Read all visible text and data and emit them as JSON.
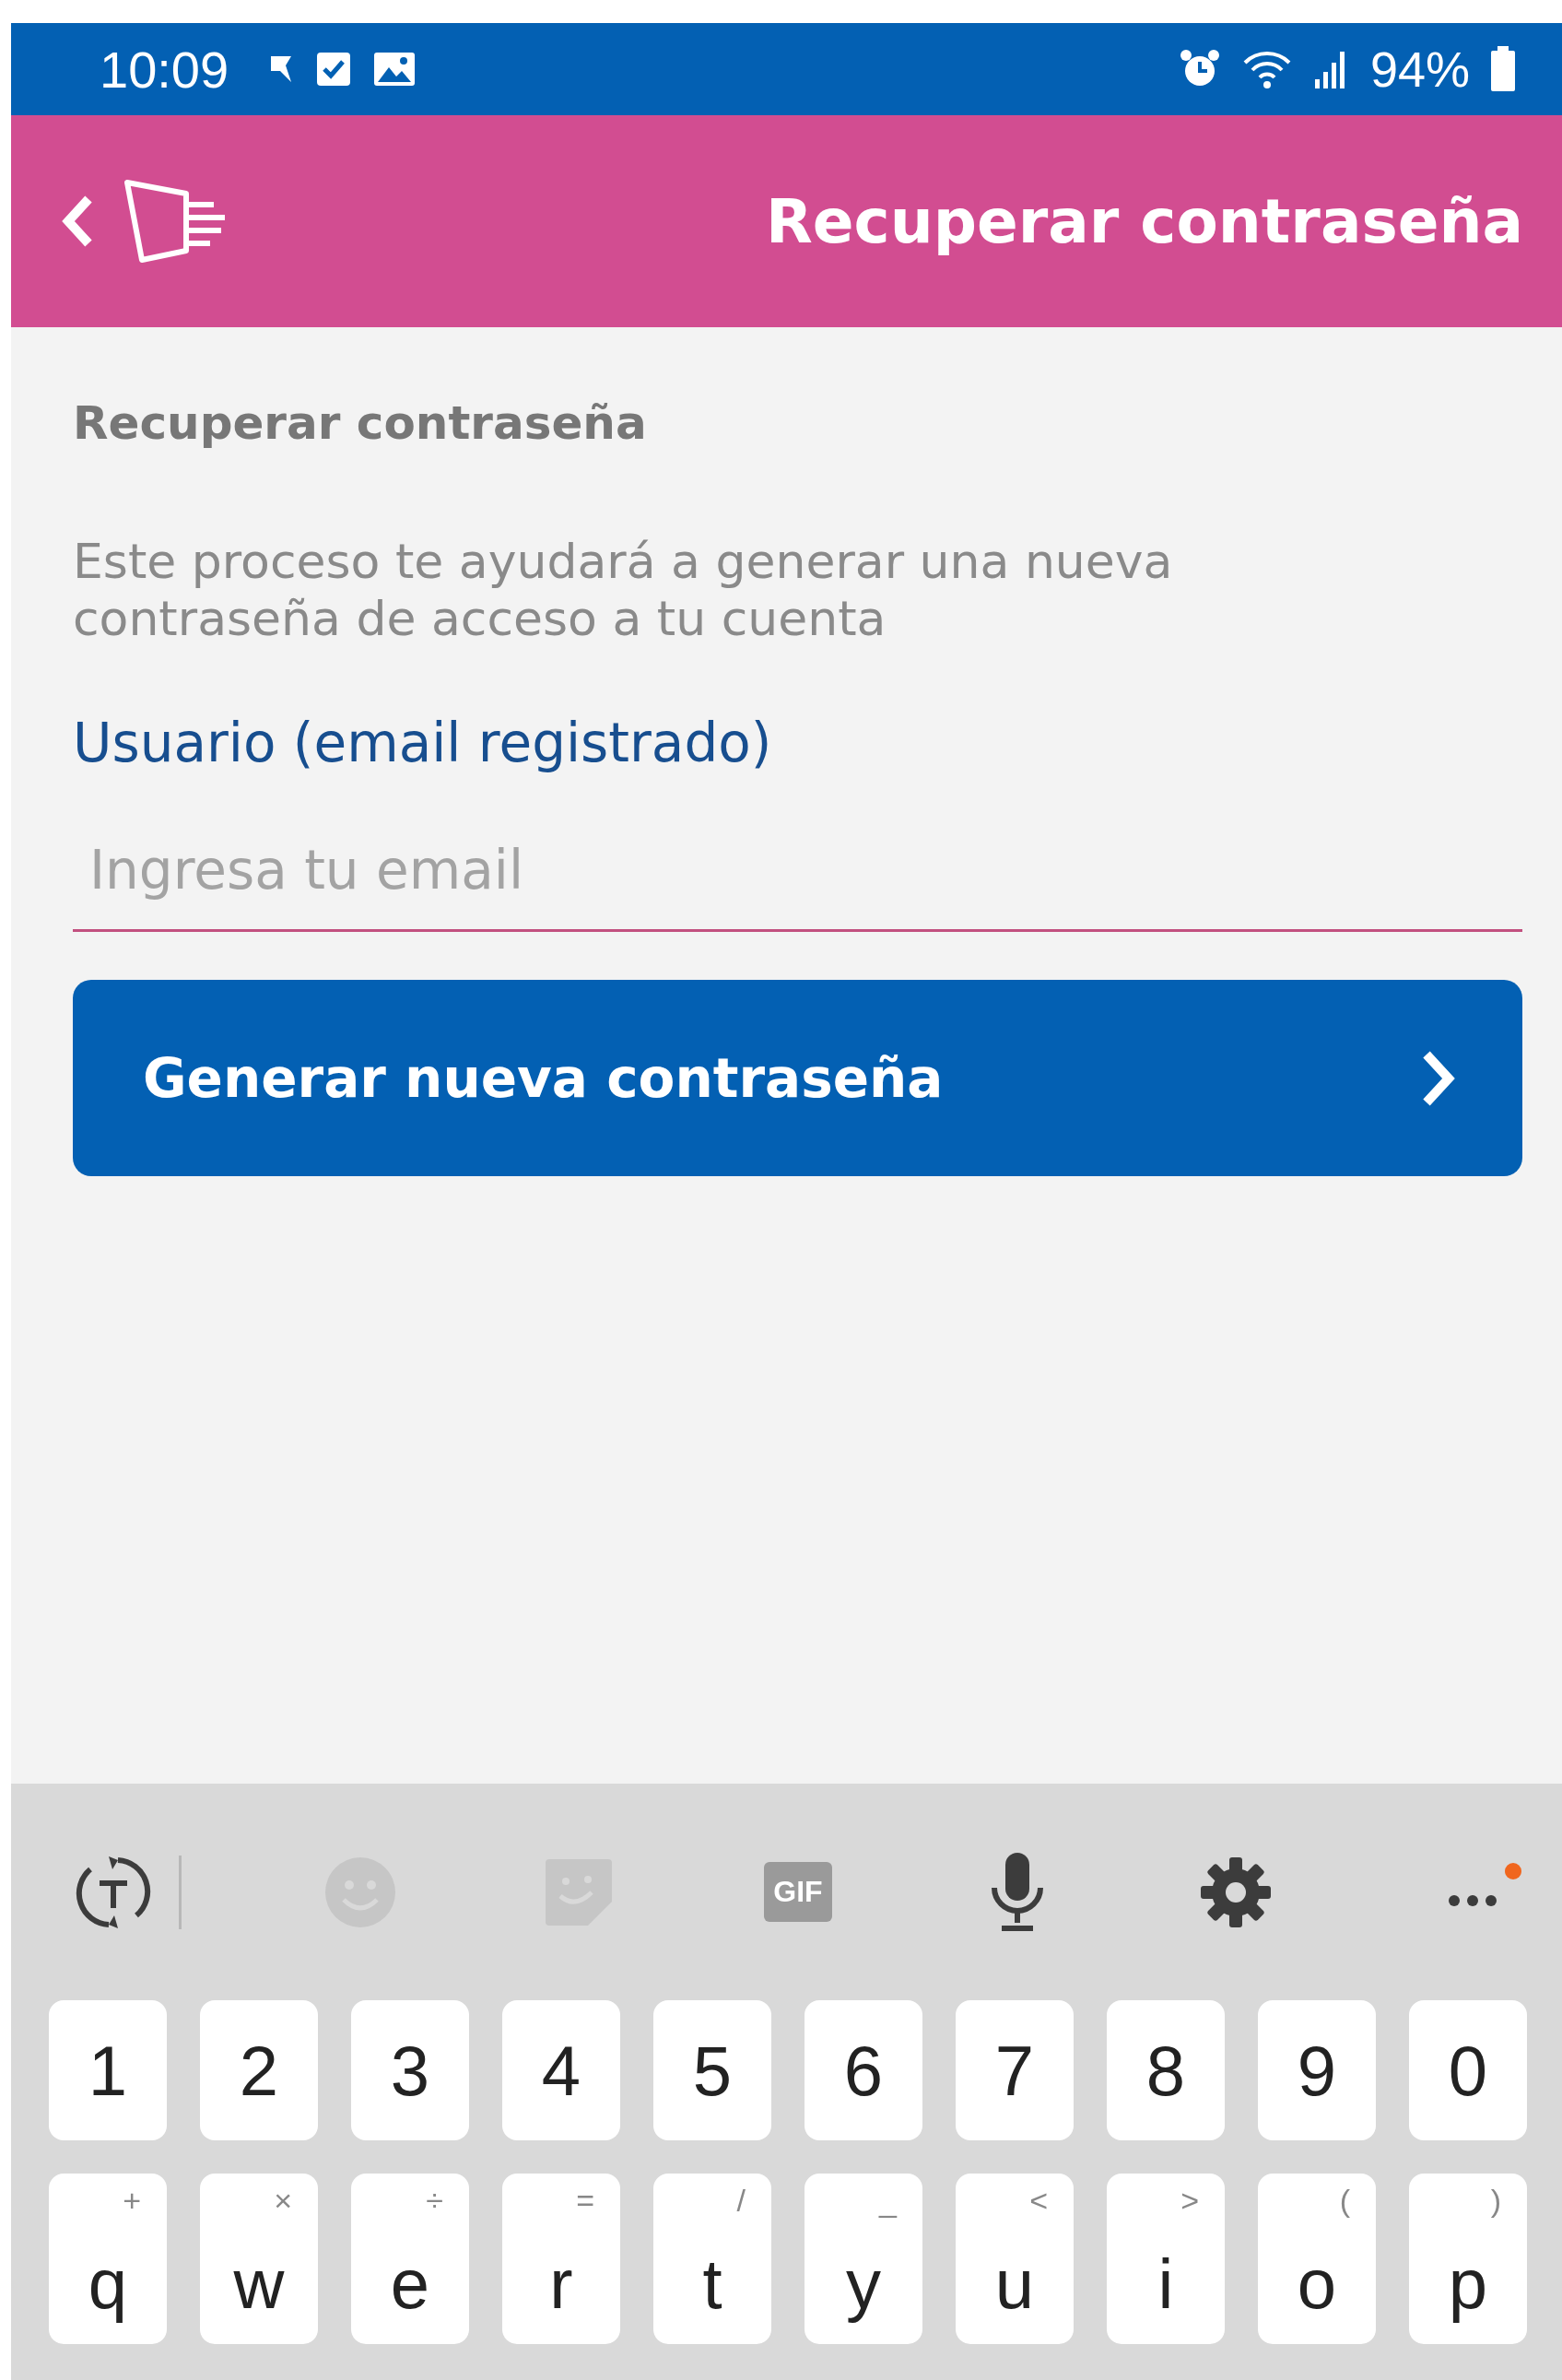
{
  "status_bar": {
    "time": "10:09",
    "battery": "94%"
  },
  "header": {
    "title": "Recuperar contraseña"
  },
  "form": {
    "heading": "Recuperar contraseña",
    "description": "Este proceso te ayudará a generar una nueva contraseña de acceso a tu cuenta",
    "field_label": "Usuario (email registrado)",
    "email": {
      "placeholder": "Ingresa tu email"
    },
    "submit": "Generar nueva contraseña"
  },
  "keyboard": {
    "toolbar": [
      {
        "kind": "translate",
        "disabled": false
      },
      {
        "kind": "emoji",
        "disabled": true
      },
      {
        "kind": "sticker",
        "disabled": true
      },
      {
        "kind": "gif",
        "disabled": true,
        "label": "GIF"
      },
      {
        "kind": "mic",
        "disabled": false
      },
      {
        "kind": "settings",
        "disabled": false
      },
      {
        "kind": "more",
        "disabled": false,
        "notification": true
      }
    ],
    "rows": [
      [
        {
          "main": "1"
        },
        {
          "main": "2"
        },
        {
          "main": "3"
        },
        {
          "main": "4"
        },
        {
          "main": "5"
        },
        {
          "main": "6"
        },
        {
          "main": "7"
        },
        {
          "main": "8"
        },
        {
          "main": "9"
        },
        {
          "main": "0"
        }
      ],
      [
        {
          "main": "q",
          "alt": "+"
        },
        {
          "main": "w",
          "alt": "×"
        },
        {
          "main": "e",
          "alt": "÷"
        },
        {
          "main": "r",
          "alt": "="
        },
        {
          "main": "t",
          "alt": "/"
        },
        {
          "main": "y",
          "alt": "_"
        },
        {
          "main": "u",
          "alt": "<"
        },
        {
          "main": "i",
          "alt": ">"
        },
        {
          "main": "o",
          "alt": "("
        },
        {
          "main": "p",
          "alt": ")"
        }
      ]
    ]
  }
}
